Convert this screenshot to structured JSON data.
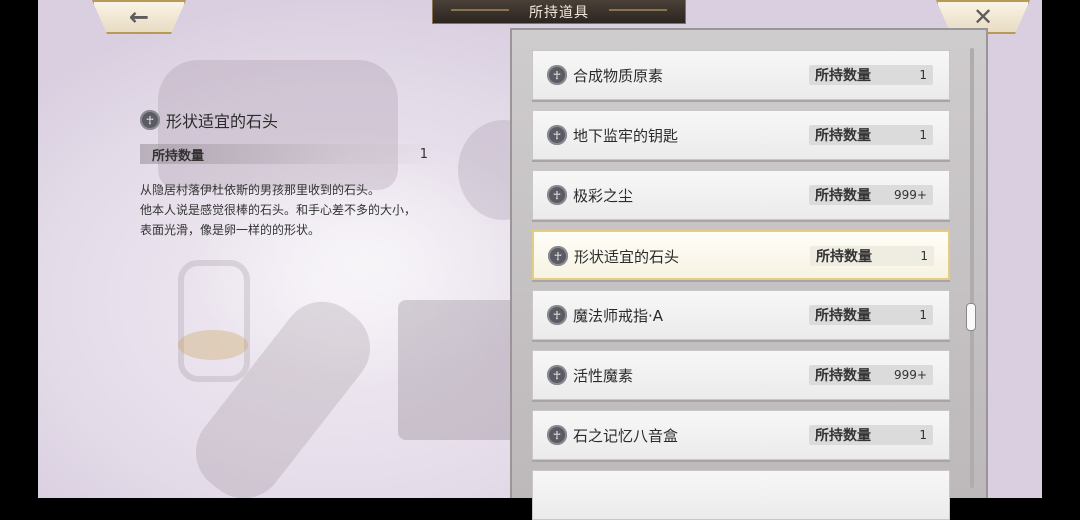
{
  "header": {
    "title": "所持道具",
    "back_icon": "arrow-left-icon",
    "close_icon": "close-icon"
  },
  "detail": {
    "name": "形状适宜的石头",
    "qty_label": "所持数量",
    "qty_value": "1",
    "description_lines": [
      "从隐居村落伊杜依斯的男孩那里收到的石头。",
      "他本人说是感觉很棒的石头。和手心差不多的大小，",
      "表面光滑，像是卵一样的的形状。"
    ]
  },
  "items": [
    {
      "name": "合成物质原素",
      "qty_label": "所持数量",
      "qty": "1",
      "selected": false
    },
    {
      "name": "地下监牢的钥匙",
      "qty_label": "所持数量",
      "qty": "1",
      "selected": false
    },
    {
      "name": "极彩之尘",
      "qty_label": "所持数量",
      "qty": "999+",
      "selected": false
    },
    {
      "name": "形状适宜的石头",
      "qty_label": "所持数量",
      "qty": "1",
      "selected": true
    },
    {
      "name": "魔法师戒指·A",
      "qty_label": "所持数量",
      "qty": "1",
      "selected": false
    },
    {
      "name": "活性魔素",
      "qty_label": "所持数量",
      "qty": "999+",
      "selected": false
    },
    {
      "name": "石之记忆八音盒",
      "qty_label": "所持数量",
      "qty": "1",
      "selected": false
    }
  ],
  "scroll_position": 0.62,
  "colors": {
    "selected_border": "#e4cc82",
    "panel_bg": "#cfcccd"
  }
}
